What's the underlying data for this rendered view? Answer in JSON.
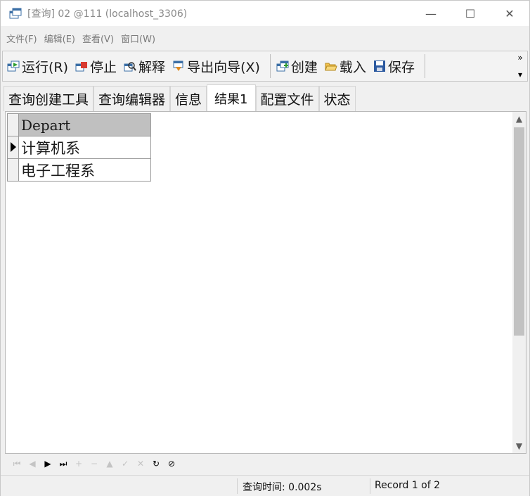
{
  "window": {
    "title": "[查询] 02 @111 (localhost_3306)",
    "icon": "query-window-icon",
    "minimize": "—",
    "maximize": "☐",
    "close": "✕"
  },
  "menu": [
    "文件(F)",
    "编辑(E)",
    "查看(V)",
    "窗口(W)"
  ],
  "toolbar": {
    "run": "运行(R)",
    "stop": "停止",
    "explain": "解释",
    "export": "导出向导(X)",
    "create": "创建",
    "load": "载入",
    "save": "保存",
    "more": "»",
    "more_down": "▾"
  },
  "tabs": [
    "查询创建工具",
    "查询编辑器",
    "信息",
    "结果1",
    "配置文件",
    "状态"
  ],
  "active_tab": "结果1",
  "result": {
    "columns": [
      "Depart"
    ],
    "rows": [
      [
        "计算机系"
      ],
      [
        "电子工程系"
      ]
    ],
    "current_row": 0
  },
  "navigator": {
    "first": "⏮",
    "prev": "◀",
    "next": "▶",
    "last": "⏭",
    "insert": "+",
    "delete": "−",
    "edit": "▲",
    "post": "✓",
    "cancel": "✕",
    "refresh": "↻",
    "stop": "⊘"
  },
  "status": {
    "query_time": "查询时间: 0.002s",
    "record": "Record 1 of 2"
  },
  "colors": {
    "header_bg": "#c0c0c0",
    "toolbar_bg": "#f3f3f3",
    "window_bg": "#f0f0f0"
  }
}
